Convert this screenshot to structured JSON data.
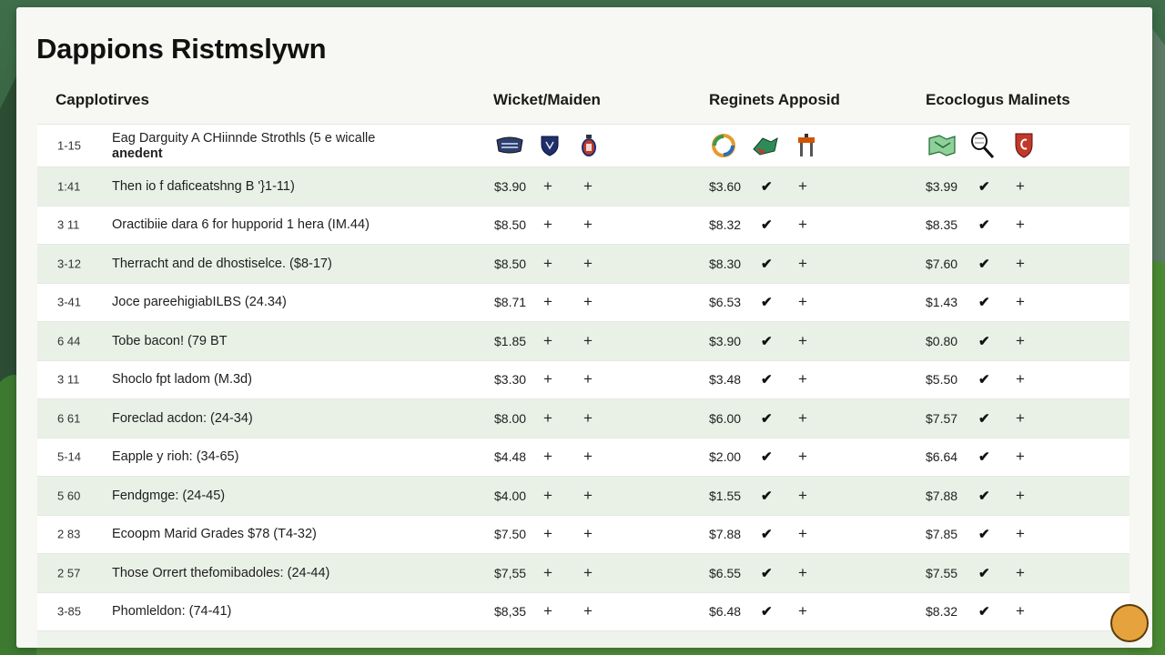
{
  "title": "Dappions Ristmslywn",
  "columns": [
    "Capplotirves",
    "Wicket/Maiden",
    "Reginets Apposid",
    "Ecoclogus Malinets"
  ],
  "header_row": {
    "num": "1-15",
    "desc_line1": "Eag Darguity A CHiinnde Strothls (5 e wicalle",
    "desc_line2": "anedent",
    "icons": [
      "crest-icon",
      "shield-icon",
      "lantern-icon",
      "wreath-icon",
      "bird-icon",
      "chair-icon",
      "map-icon",
      "racket-icon",
      "shield-c-icon"
    ]
  },
  "rows": [
    {
      "num": "1:41",
      "desc": "Then io f daficeatshng B '}1-11)",
      "p1": "$3.90",
      "p2": "$3.60",
      "p3": "$3.99"
    },
    {
      "num": "3 11",
      "desc": "Oractibiie dara 6 for hupporid 1 hera (IM.44)",
      "p1": "$8.50",
      "p2": "$8.32",
      "p3": "$8.35"
    },
    {
      "num": "3-12",
      "desc": "Therracht and de dhostiselce. ($8-17)",
      "p1": "$8.50",
      "p2": "$8.30",
      "p3": "$7.60"
    },
    {
      "num": "3-41",
      "desc": "Joce pareehigiabILBS (24.34)",
      "p1": "$8.71",
      "p2": "$6.53",
      "p3": "$1.43"
    },
    {
      "num": "6 44",
      "desc": "Tobe bacon! (79 BT",
      "p1": "$1.85",
      "p2": "$3.90",
      "p3": "$0.80"
    },
    {
      "num": "3 11",
      "desc": "Shoclo fpt ladom (M.3d)",
      "p1": "$3.30",
      "p2": "$3.48",
      "p3": "$5.50"
    },
    {
      "num": "6 61",
      "desc": "Foreclad acdon: (24-34)",
      "p1": "$8.00",
      "p2": "$6.00",
      "p3": "$7.57"
    },
    {
      "num": "5-14",
      "desc": "Eapple y rioh: (34-65)",
      "p1": "$4.48",
      "p2": "$2.00",
      "p3": "$6.64"
    },
    {
      "num": "5 60",
      "desc": "Fendgmge: (24-45)",
      "p1": "$4.00",
      "p2": "$1.55",
      "p3": "$7.88"
    },
    {
      "num": "2 83",
      "desc": "Ecoopm Marid Grades $78 (T4-32)",
      "p1": "$7.50",
      "p2": "$7.88",
      "p3": "$7.85"
    },
    {
      "num": "2 57",
      "desc": "Those Orrert thefomibadoles: (24-44)",
      "p1": "$7,55",
      "p2": "$6.55",
      "p3": "$7.55"
    },
    {
      "num": "3-85",
      "desc": "Phomleldon: (74-41)",
      "p1": "$8,35",
      "p2": "$6.48",
      "p3": "$8.32"
    }
  ],
  "symbols": {
    "plus": "+",
    "check": "✔"
  },
  "colors": {
    "alt_row": "#e9f1e6",
    "panel": "#f7f7f3",
    "background": "#2f5a3a"
  }
}
